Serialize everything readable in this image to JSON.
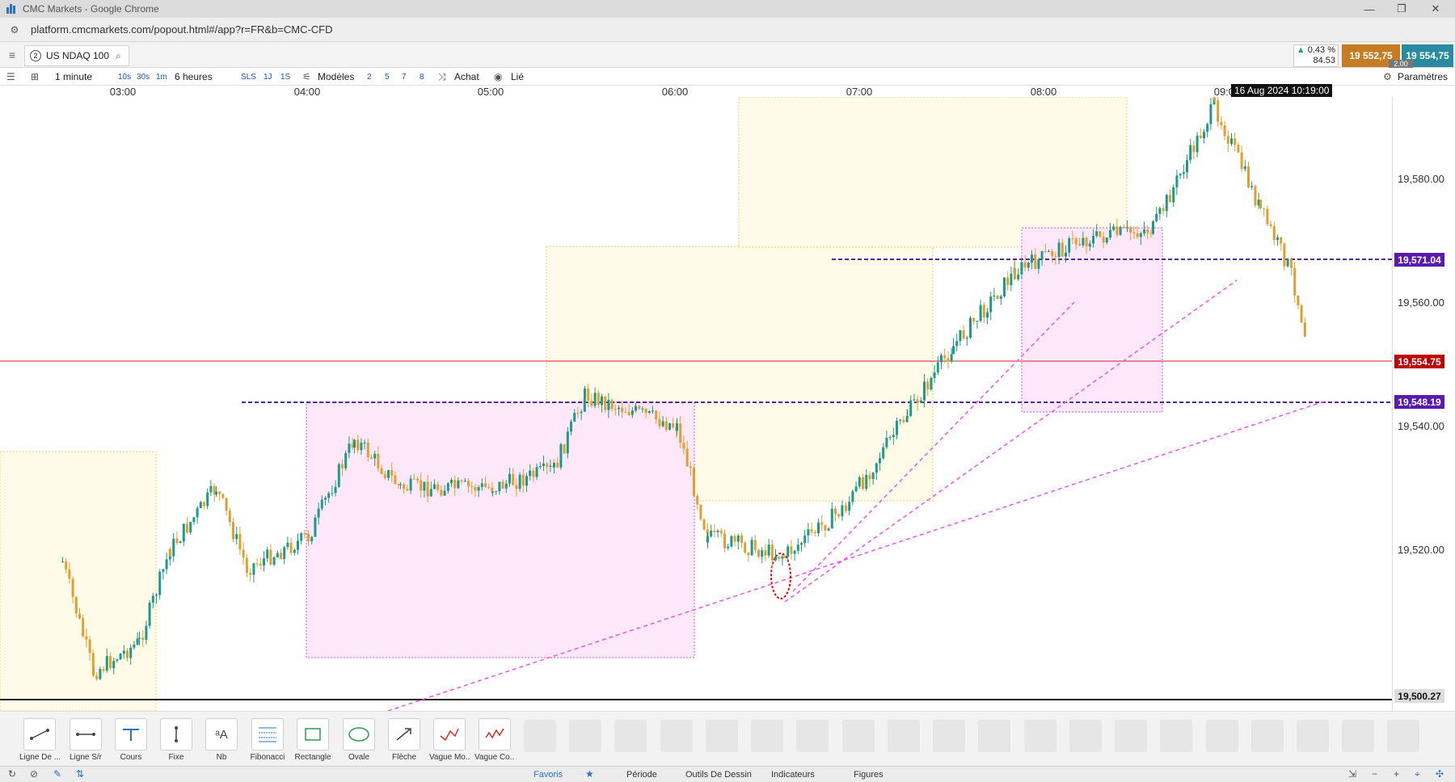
{
  "window": {
    "title": "CMC Markets - Google Chrome"
  },
  "browser": {
    "url": "platform.cmcmarkets.com/popout.html#/app?r=FR&b=CMC-CFD"
  },
  "instrument": {
    "tab_number": "2",
    "name": "US NDAQ 100"
  },
  "quote": {
    "change_pct": "0.43 %",
    "change_pts": "84.53",
    "sell": "19 552,75",
    "buy": "19 554,75",
    "spread": "2.00"
  },
  "toolbar": {
    "interval": "1 minute",
    "quick_intervals": [
      "10s",
      "30s",
      "1m"
    ],
    "range": "6 heures",
    "quick_ranges": [
      "SLS",
      "1J",
      "1S"
    ],
    "models_label": "Modèles",
    "model_numbers": [
      "2",
      "5",
      "7",
      "8"
    ],
    "buy_label": "Achat",
    "linked_label": "Lié",
    "settings_label": "Paramètres"
  },
  "time_axis": {
    "labels": [
      "03:00",
      "04:00",
      "05:00",
      "06:00",
      "07:00",
      "08:00",
      "09:00"
    ],
    "cursor_time": "16 Aug 2024 10:19:00"
  },
  "price_axis": {
    "labels": [
      "19,580.00",
      "19,560.00",
      "19,540.00",
      "19,520.00"
    ],
    "tags": {
      "level_high": "19,571.04",
      "current": "19,554.75",
      "level_low": "19,548.19",
      "bottom": "19,500.27"
    }
  },
  "chart_data": {
    "type": "candlestick",
    "instrument": "US NDAQ 100",
    "interval": "1 minute",
    "x_ticks": [
      "03:00",
      "04:00",
      "05:00",
      "06:00",
      "07:00",
      "08:00",
      "09:00"
    ],
    "y_ticks": [
      19580,
      19560,
      19540,
      19520
    ],
    "ylim": [
      19497,
      19597
    ],
    "horizontal_lines": [
      19571.04,
      19554.75,
      19548.19,
      19500.27
    ],
    "closes_approx": [
      {
        "t": "02:40",
        "v": 19518
      },
      {
        "t": "02:50",
        "v": 19500
      },
      {
        "t": "03:05",
        "v": 19505
      },
      {
        "t": "03:15",
        "v": 19520
      },
      {
        "t": "03:30",
        "v": 19530
      },
      {
        "t": "03:40",
        "v": 19517
      },
      {
        "t": "04:00",
        "v": 19522
      },
      {
        "t": "04:15",
        "v": 19538
      },
      {
        "t": "04:30",
        "v": 19530
      },
      {
        "t": "05:00",
        "v": 19530
      },
      {
        "t": "05:20",
        "v": 19533
      },
      {
        "t": "05:30",
        "v": 19545
      },
      {
        "t": "06:00",
        "v": 19540
      },
      {
        "t": "06:10",
        "v": 19522
      },
      {
        "t": "06:35",
        "v": 19519
      },
      {
        "t": "06:55",
        "v": 19527
      },
      {
        "t": "07:15",
        "v": 19542
      },
      {
        "t": "07:30",
        "v": 19553
      },
      {
        "t": "07:50",
        "v": 19565
      },
      {
        "t": "08:10",
        "v": 19570
      },
      {
        "t": "08:35",
        "v": 19572
      },
      {
        "t": "08:55",
        "v": 19592
      },
      {
        "t": "09:10",
        "v": 19575
      },
      {
        "t": "09:20",
        "v": 19565
      },
      {
        "t": "09:25",
        "v": 19554
      }
    ]
  },
  "drawing_tools": [
    "Ligne De ...",
    "Ligne S/r",
    "Cours",
    "Fixe",
    "Nb",
    "Fibonacci",
    "Rectangle",
    "Ovale",
    "Flèche",
    "Vague Mo...",
    "Vague Co..."
  ],
  "bottom_tabs": [
    "Favoris",
    "Période",
    "Outils De Dessin",
    "Indicateurs",
    "Figures"
  ],
  "colors": {
    "bull": "#1e9a8a",
    "bear": "#e0a030",
    "accent": "#2a72c8",
    "current_price": "#c00000",
    "level": "#6a1ab0"
  }
}
